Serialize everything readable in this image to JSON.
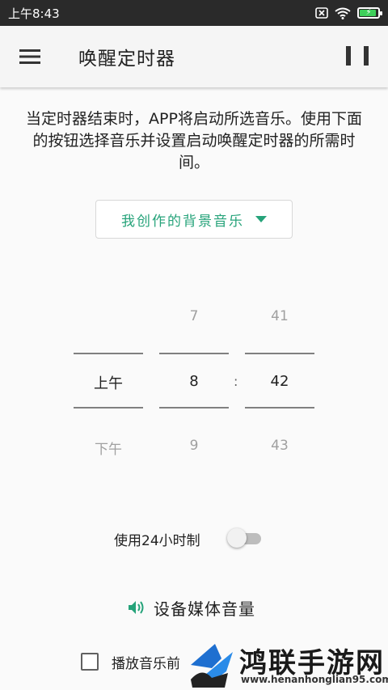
{
  "status_bar": {
    "time": "上午8:43",
    "icons": [
      "sim-x-icon",
      "wifi-icon",
      "battery-charging-icon"
    ]
  },
  "toolbar": {
    "title": "唤醒定时器",
    "menu_icon": "hamburger-menu-icon",
    "pause_icon": "pause-icon"
  },
  "description": "当定时器结束时，APP将启动所选音乐。使用下面的按钮选择音乐并设置启动唤醒定时器的所需时间。",
  "music_select": {
    "value": "我创作的背景音乐"
  },
  "time_picker": {
    "ampm": {
      "above": "",
      "selected": "上午",
      "below": "下午"
    },
    "hour": {
      "above": "7",
      "selected": "8",
      "below": "9"
    },
    "minute": {
      "above": "41",
      "selected": "42",
      "below": "43"
    },
    "separator": ":"
  },
  "toggle_24h": {
    "label": "使用24小时制",
    "checked": false
  },
  "volume": {
    "label": "设备媒体音量",
    "icon": "speaker-icon"
  },
  "checkbox": {
    "label": "播放音乐前",
    "checked": false
  },
  "watermark": {
    "title": "鸿联手游网",
    "url": "www.henanhonglian95.com"
  },
  "colors": {
    "accent": "#26a37a",
    "status_bar": "#2a2a2a",
    "toolbar": "#f5f5f5"
  }
}
